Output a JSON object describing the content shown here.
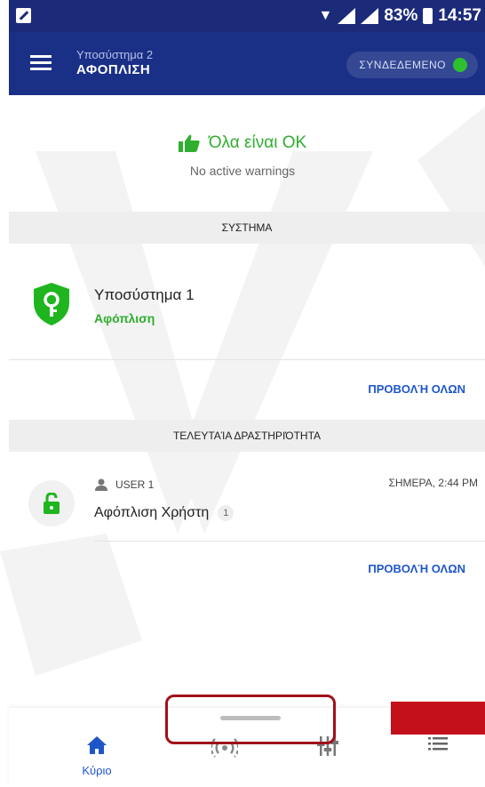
{
  "status_bar": {
    "battery": "83%",
    "time": "14:57"
  },
  "header": {
    "subtitle": "Υποσύστημα 2",
    "title": "ΑΦΟΠΛΙΣΗ",
    "connection_status": "ΣΥΝΔΕΔΕΜΕΝΟ"
  },
  "summary": {
    "title": "Όλα είναι ΟΚ",
    "subtitle": "No active warnings"
  },
  "system_section": {
    "header": "ΣΥΣΤΗΜΑ",
    "partition": {
      "name": "Υποσύστημα 1",
      "state": "Αφόπλιση"
    },
    "view_all": "ΠΡΟΒΟΛΉ ΟΛΩΝ"
  },
  "activity_section": {
    "header": "ΤΕΛΕΥΤΑΊΑ ΔΡΑΣΤΗΡΙΌΤΗΤΑ",
    "item": {
      "user": "USER 1",
      "time": "ΣΗΜΕΡΑ, 2:44 PM",
      "action": "Αφόπλιση Χρήστη",
      "count": "1"
    },
    "view_all": "ΠΡΟΒΟΛΉ ΟΛΩΝ"
  },
  "bottom_nav": {
    "home_label": "Κύριο",
    "active_color": "#1e56c9"
  },
  "colors": {
    "primary": "#1a2f86",
    "success": "#2fae2f",
    "link": "#1e56c9"
  }
}
